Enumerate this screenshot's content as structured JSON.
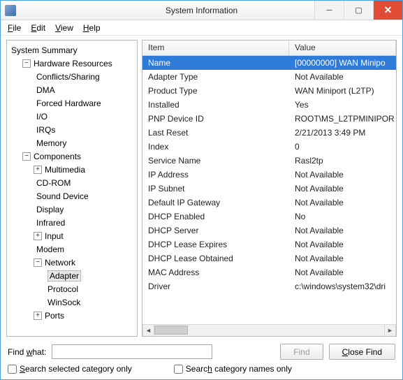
{
  "window": {
    "title": "System Information"
  },
  "menus": {
    "file": "File",
    "edit": "Edit",
    "view": "View",
    "help": "Help"
  },
  "tree": {
    "root": "System Summary",
    "hw": "Hardware Resources",
    "hw_items": [
      "Conflicts/Sharing",
      "DMA",
      "Forced Hardware",
      "I/O",
      "IRQs",
      "Memory"
    ],
    "comp": "Components",
    "comp_items1": [
      "Multimedia",
      "CD-ROM",
      "Sound Device",
      "Display",
      "Infrared",
      "Input",
      "Modem"
    ],
    "network": "Network",
    "net_items": [
      "Adapter",
      "Protocol",
      "WinSock"
    ],
    "ports": "Ports"
  },
  "list": {
    "col_item": "Item",
    "col_value": "Value",
    "rows": [
      {
        "item": "Name",
        "value": "[00000000] WAN Minipo"
      },
      {
        "item": "Adapter Type",
        "value": "Not Available"
      },
      {
        "item": "Product Type",
        "value": "WAN Miniport (L2TP)"
      },
      {
        "item": "Installed",
        "value": "Yes"
      },
      {
        "item": "PNP Device ID",
        "value": "ROOT\\MS_L2TPMINIPOR"
      },
      {
        "item": "Last Reset",
        "value": "2/21/2013 3:49 PM"
      },
      {
        "item": "Index",
        "value": "0"
      },
      {
        "item": "Service Name",
        "value": "Rasl2tp"
      },
      {
        "item": "IP Address",
        "value": "Not Available"
      },
      {
        "item": "IP Subnet",
        "value": "Not Available"
      },
      {
        "item": "Default IP Gateway",
        "value": "Not Available"
      },
      {
        "item": "DHCP Enabled",
        "value": "No"
      },
      {
        "item": "DHCP Server",
        "value": "Not Available"
      },
      {
        "item": "DHCP Lease Expires",
        "value": "Not Available"
      },
      {
        "item": "DHCP Lease Obtained",
        "value": "Not Available"
      },
      {
        "item": "MAC Address",
        "value": "Not Available"
      },
      {
        "item": "Driver",
        "value": "c:\\windows\\system32\\dri"
      }
    ]
  },
  "findbar": {
    "label_pre": "Find ",
    "label_ul": "w",
    "label_post": "hat:",
    "find_btn": "Find",
    "close_pre": "",
    "close_ul": "C",
    "close_post": "lose Find"
  },
  "checks": {
    "c1_ul": "S",
    "c1_post": "earch selected category only",
    "c2_pre": "Searc",
    "c2_ul": "h",
    "c2_post": " category names only"
  }
}
